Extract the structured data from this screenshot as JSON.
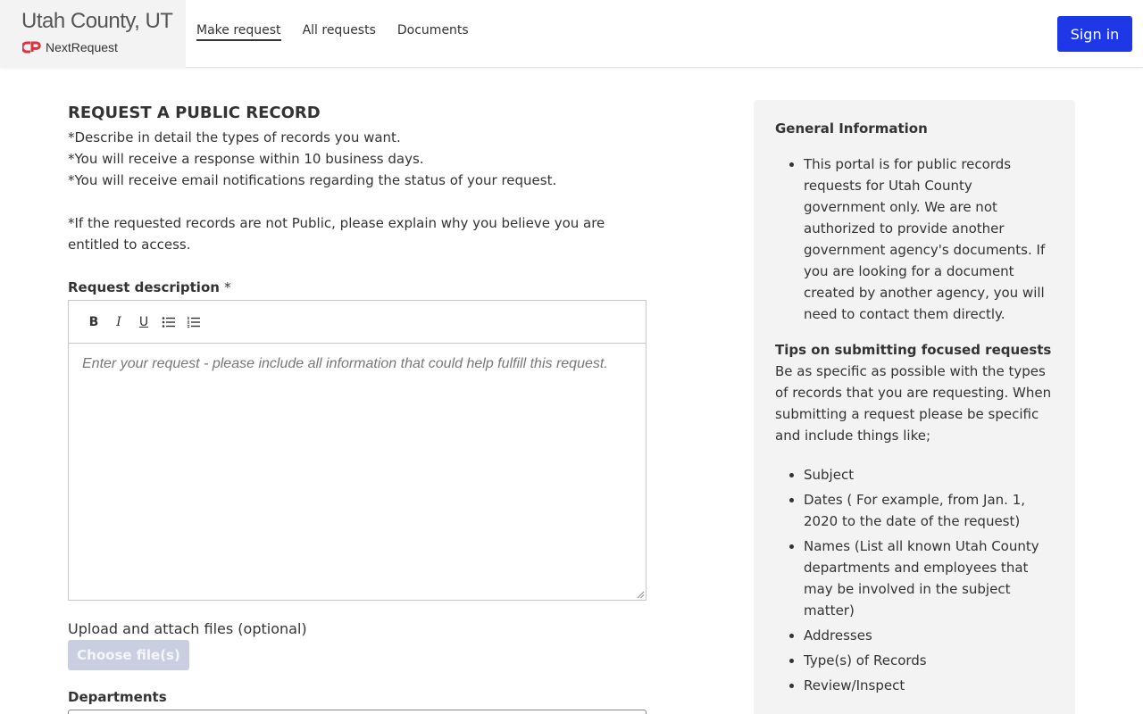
{
  "header": {
    "agency_name": "Utah County, UT",
    "logo_text": "NextRequest",
    "logo_color": "#e0303e",
    "nav": [
      {
        "label": "Make request",
        "active": true
      },
      {
        "label": "All requests",
        "active": false
      },
      {
        "label": "Documents",
        "active": false
      }
    ],
    "signin_label": "Sign in",
    "accent": "#1e38e8"
  },
  "form": {
    "title": "REQUEST A PUBLIC RECORD",
    "intro_lines": [
      "*Describe in detail the types of records you want.",
      "*You will receive a response within 10 business days.",
      "*You will receive email notifications regarding the status of your request."
    ],
    "intro_note": "*If the requested records are not Public, please explain why you believe you are entitled to access.",
    "description_label": "Request description",
    "required_marker": "*",
    "toolbar": {
      "bold": "B",
      "italic": "I",
      "underline": "U",
      "bullet_list_icon": "bullet-list-icon",
      "numbered_list_icon": "numbered-list-icon"
    },
    "description_placeholder": "Enter your request - please include all information that could help fulfill this request.",
    "upload_label": "Upload and attach files (optional)",
    "choose_files_label": "Choose file(s)",
    "departments_label": "Departments"
  },
  "sidebar": {
    "general_title": "General Information",
    "general_items": [
      "This portal is for public records requests for Utah County government only. We are not authorized to provide another government agency's documents. If you are looking for a document created by another agency, you will need to contact them directly."
    ],
    "tips_title": "Tips on submitting focused requests",
    "tips_text": "Be as specific as possible with the types of records that you are requesting. When submitting a request please be specific and include things like;",
    "tips_items": [
      "Subject",
      "Dates ( For example, from Jan. 1, 2020 to the date of the request)",
      "Names (List all known Utah County departments and employees that may be involved in the subject matter)",
      "Addresses",
      "Type(s) of Records",
      "Review/Inspect"
    ]
  }
}
